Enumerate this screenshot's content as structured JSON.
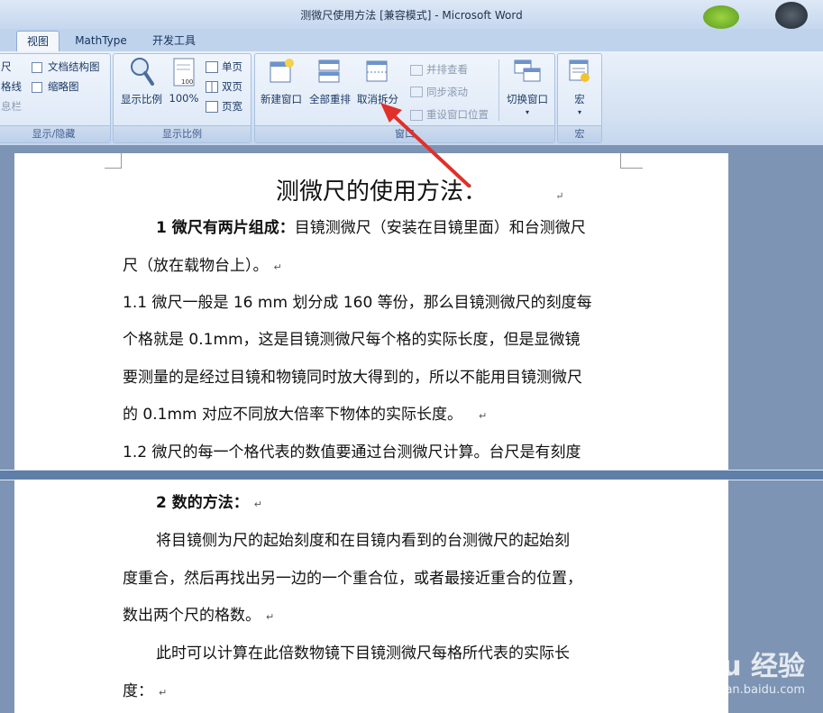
{
  "window": {
    "title": "测微尺使用方法 [兼容模式] - Microsoft Word"
  },
  "tabs": [
    {
      "label": "视图",
      "active": true
    },
    {
      "label": "MathType",
      "active": false
    },
    {
      "label": "开发工具",
      "active": false
    }
  ],
  "ribbon": {
    "show_hide": {
      "label": "显示/隐藏",
      "items_left": [
        "尺",
        "格线",
        "息栏"
      ],
      "checks": [
        "文档结构图",
        "缩略图"
      ]
    },
    "zoom": {
      "label": "显示比例",
      "zoom_button": "显示比例",
      "hundred_button": "100%",
      "hundred_icon_text": "100",
      "one_page": "单页",
      "two_pages": "双页",
      "page_width": "页宽"
    },
    "window": {
      "label": "窗口",
      "new_window": "新建窗口",
      "arrange_all": "全部重排",
      "remove_split": "取消拆分",
      "side_by_side": "并排查看",
      "sync_scroll": "同步滚动",
      "reset_position": "重设窗口位置",
      "switch_windows": "切换窗口"
    },
    "macros": {
      "label": "宏",
      "button": "宏"
    }
  },
  "document": {
    "heading": "测微尺的使用方法：",
    "top_pane": [
      {
        "bold": "1 微尺有两片组成：",
        "text": "目镜测微尺（安装在目镜里面）和台测微尺"
      },
      {
        "bold": "",
        "text": "尺（放在载物台上）。"
      },
      {
        "bold": "",
        "text": "1.1 微尺一般是 16 mm 划分成 160 等份，那么目镜测微尺的刻度每"
      },
      {
        "bold": "",
        "text": "个格就是 0.1mm，这是目镜测微尺每个格的实际长度，但是显微镜"
      },
      {
        "bold": "",
        "text": "要测量的是经过目镜和物镜同时放大得到的，所以不能用目镜测微尺"
      },
      {
        "bold": "",
        "text": "的 0.1mm 对应不同放大倍率下物体的实际长度。"
      },
      {
        "bold": "",
        "text": "1.2 微尺的每一个格代表的数值要通过台测微尺计算。台尺是有刻度"
      }
    ],
    "bottom_pane": [
      {
        "bold": "2 数的方法：",
        "text": ""
      },
      {
        "bold": "",
        "text": "将目镜侧为尺的起始刻度和在目镜内看到的台测微尺的起始刻"
      },
      {
        "bold": "",
        "text": "度重合，然后再找出另一边的一个重合位，或者最接近重合的位置，"
      },
      {
        "bold": "",
        "text": "数出两个尺的格数。"
      },
      {
        "bold": "",
        "text": "此时可以计算在此倍数物镜下目镜测微尺每格所代表的实际长"
      },
      {
        "bold": "",
        "text": "度："
      }
    ],
    "paragraph_mark": "↵"
  },
  "watermark": {
    "logo": "Bai du 经验",
    "url": "jingyan.baidu.com"
  },
  "colors": {
    "arrow": "#e0302a",
    "ribbon_text": "#1d3a66"
  }
}
